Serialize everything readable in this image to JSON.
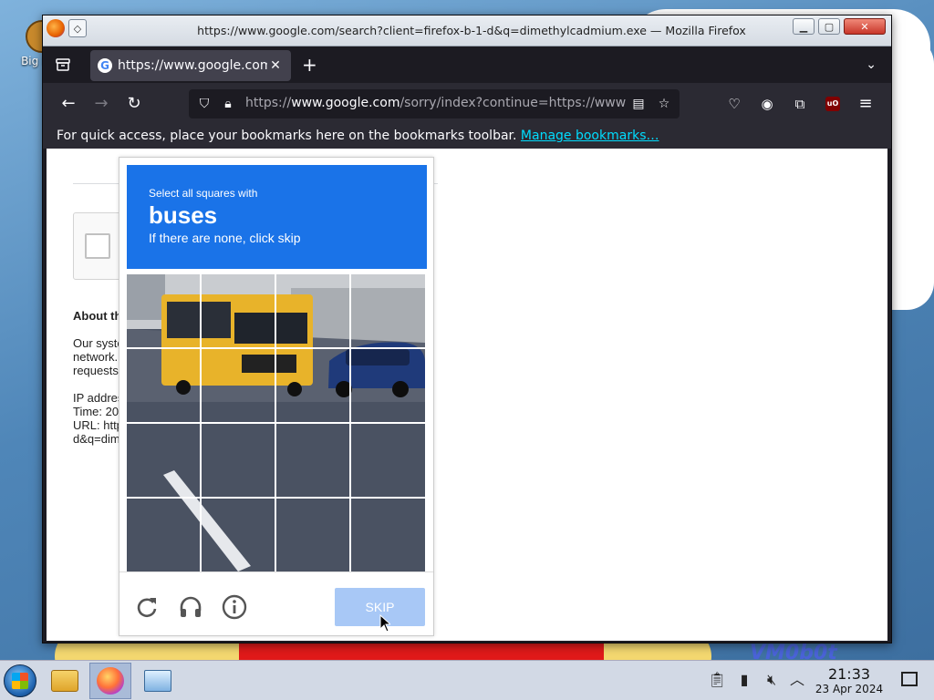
{
  "desktop": {
    "icon_label": "Big Des",
    "watermark": "VM0b0t"
  },
  "window": {
    "title": "https://www.google.com/search?client=firefox-b-1-d&q=dimethylcadmium.exe — Mozilla Firefox",
    "tab_title": "https://www.google.com/",
    "url_host": "www.google.com",
    "url_prefix": "https://",
    "url_rest": "/sorry/index?continue=https://www",
    "bookmarks_message": "For quick access, place your bookmarks here on the bookmarks toolbar.",
    "bookmarks_link": "Manage bookmarks…"
  },
  "page": {
    "about_heading": "About th",
    "para_line1": "Our syste",
    "para_line2": "network.",
    "para_line3": "requests",
    "ip_line": "IP addres",
    "time_line": "Time: 20",
    "url_line": "URL: http",
    "url_line2": "d&q=dim"
  },
  "captcha": {
    "instruction": "Select all squares with",
    "target": "buses",
    "hint": "If there are none, click skip",
    "skip_label": "SKIP",
    "grid_rows": 4,
    "grid_cols": 4,
    "colors": {
      "header": "#1a73e8",
      "skip_bg": "#a8c8f6"
    },
    "controls": [
      "reload-icon",
      "headphones-icon",
      "info-icon"
    ]
  },
  "taskbar": {
    "time": "21:33",
    "date": "23 Apr 2024"
  }
}
